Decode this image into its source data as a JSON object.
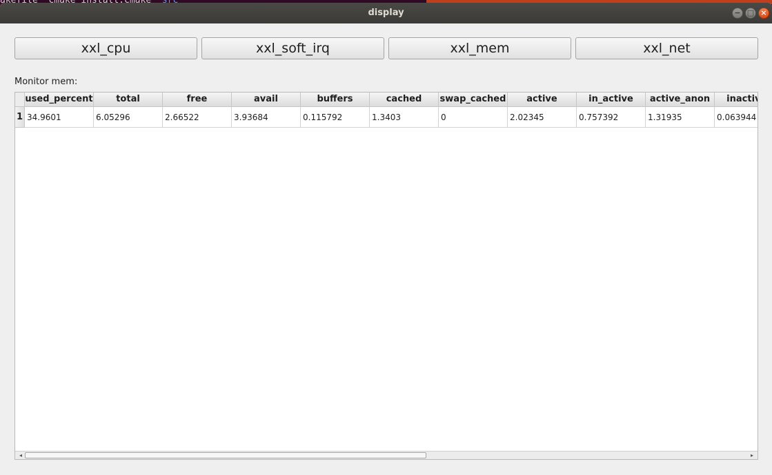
{
  "background": {
    "terminal_text": "akefile  cmake_install.cmake  ",
    "terminal_highlight": "src"
  },
  "window": {
    "title": "display",
    "controls": {
      "minimize_icon": "−",
      "maximize_icon": "□",
      "close_icon": "×"
    }
  },
  "toolbar": {
    "buttons": [
      {
        "label": "xxl_cpu"
      },
      {
        "label": "xxl_soft_irq"
      },
      {
        "label": "xxl_mem"
      },
      {
        "label": "xxl_net"
      }
    ]
  },
  "monitor": {
    "label": "Monitor mem:"
  },
  "table": {
    "columns": [
      "used_percent",
      "total",
      "free",
      "avail",
      "buffers",
      "cached",
      "swap_cached",
      "active",
      "in_active",
      "active_anon",
      "inactive_"
    ],
    "rows": [
      {
        "index": "1",
        "cells": [
          "34.9601",
          "6.05296",
          "2.66522",
          "3.93684",
          "0.115792",
          "1.3403",
          "0",
          "2.02345",
          "0.757392",
          "1.31935",
          "0.063944"
        ]
      }
    ]
  },
  "scrollbar": {
    "left_arrow": "◂",
    "right_arrow": "▸"
  },
  "colors": {
    "titlebar": "#3c3b37",
    "close_button": "#e9541b",
    "window_bg": "#efefef"
  }
}
